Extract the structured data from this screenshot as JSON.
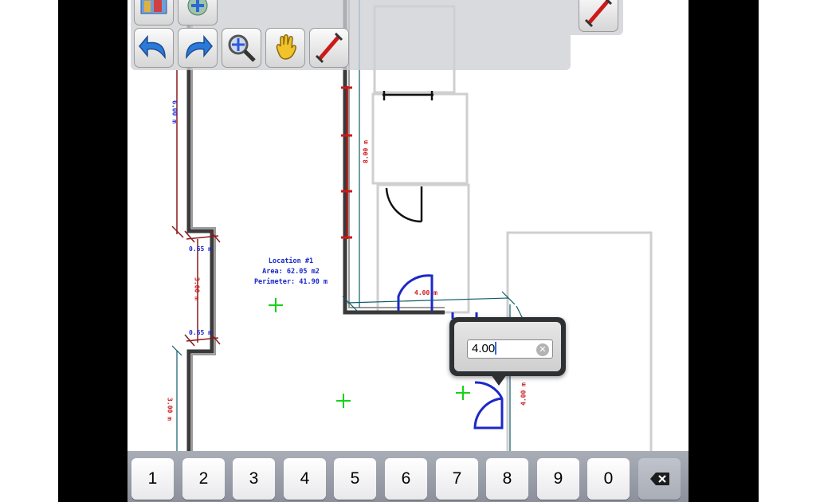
{
  "plan": {
    "location_label": "Location #1",
    "area_label": "Area: 62.05 m2",
    "perimeter_label": "Perimeter: 41.90 m",
    "dimensions": {
      "left_top": "6.00 m",
      "notch_top": "0.65 m",
      "notch_side": "3.00 m",
      "notch_bottom": "0.65 m",
      "left_bottom": "3.00 m",
      "center_vertical": "8.00 m",
      "door_bottom": "4.00 m",
      "right_vertical": "4.00 m"
    }
  },
  "toolbar": {
    "tools": [
      {
        "name": "undo-button",
        "icon": "undo-arrow-icon"
      },
      {
        "name": "redo-button",
        "icon": "redo-arrow-icon"
      },
      {
        "name": "zoom-button",
        "icon": "magnifier-icon"
      },
      {
        "name": "pan-button",
        "icon": "hand-icon"
      },
      {
        "name": "measure-button",
        "icon": "dimension-ruler-icon"
      }
    ]
  },
  "popover": {
    "value": "4.00"
  },
  "keyboard": {
    "keys": [
      "1",
      "2",
      "3",
      "4",
      "5",
      "6",
      "7",
      "8",
      "9",
      "0"
    ],
    "delete_icon": "backspace-icon"
  },
  "colors": {
    "dimension_red": "#cc1a1a",
    "dimension_blue": "#1c28c8",
    "wall": "#333333",
    "room_outline": "#c8c8c8",
    "marker_green": "#19d119"
  }
}
